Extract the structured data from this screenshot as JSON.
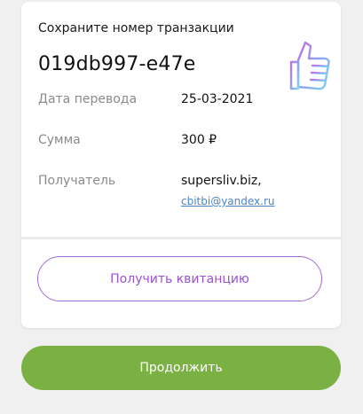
{
  "card": {
    "save_label": "Сохраните номер транзакции",
    "transaction_id": "019db997-e47e",
    "rows": [
      {
        "label": "Дата перевода",
        "value": "25-03-2021"
      },
      {
        "label": "Сумма",
        "value": "300 ₽"
      },
      {
        "label": "Получатель",
        "value": "supersliv.biz,",
        "link": "cbitbi@yandex.ru"
      }
    ],
    "icon": "thumbs-up-icon"
  },
  "buttons": {
    "receipt_label": "Получить квитанцию",
    "continue_label": "Продолжить"
  },
  "colors": {
    "accent_purple": "#9a52d6",
    "continue_green": "#7bb143",
    "link_blue": "#4a86c8"
  }
}
